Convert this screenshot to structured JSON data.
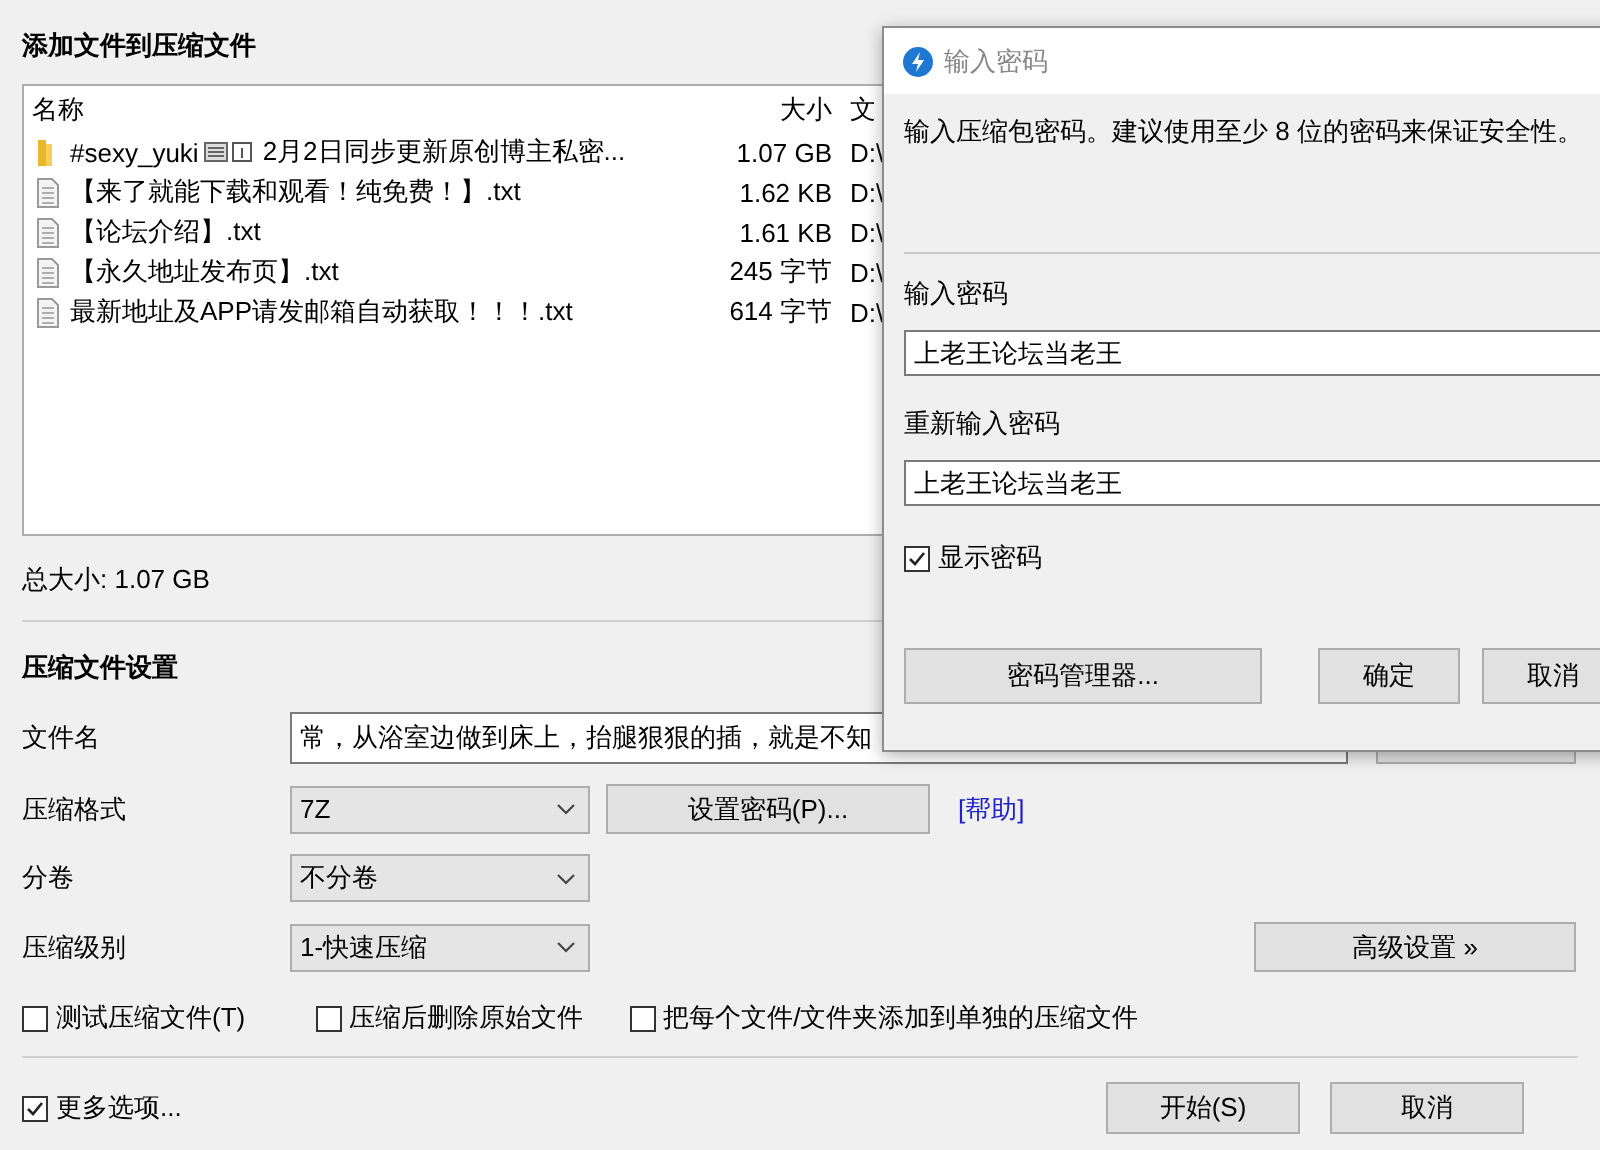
{
  "window": {
    "title": "添加文件到压缩文件"
  },
  "file_list": {
    "columns": [
      "名称",
      "大小",
      "文"
    ],
    "rows": [
      {
        "kind": "folder",
        "name": "#sexy_yuki",
        "name_suffix": "2月2日同步更新原创博主私密...",
        "size": "1.07 GB",
        "column_3": "D:\\"
      },
      {
        "kind": "file",
        "name": "【来了就能下载和观看！纯免费！】.txt",
        "size": "1.62 KB",
        "column_3": "D:\\"
      },
      {
        "kind": "file",
        "name": "【论坛介绍】.txt",
        "size": "1.61 KB",
        "column_3": "D:\\"
      },
      {
        "kind": "file",
        "name": "【永久地址发布页】.txt",
        "size": "245 字节",
        "column_3": "D:\\"
      },
      {
        "kind": "file",
        "name": "最新地址及APP请发邮箱自动获取！！！.txt",
        "size": "614 字节",
        "column_3": "D:\\"
      }
    ]
  },
  "total_size": "总大小: 1.07 GB",
  "settings": {
    "title": "压缩文件设置",
    "filename": {
      "label": "文件名",
      "value": "常，从浴室边做到床上，抬腿狠狠的插，就是不知"
    },
    "format": {
      "label": "压缩格式",
      "value": "7Z"
    },
    "set_password_button": "设置密码(P)...",
    "help_link": "[帮助]",
    "volume": {
      "label": "分卷",
      "value": "不分卷"
    },
    "level": {
      "label": "压缩级别",
      "value": "1-快速压缩"
    },
    "advanced_button": "高级设置 »",
    "options": [
      {
        "label": "测试压缩文件(T)",
        "checked": false
      },
      {
        "label": "压缩后删除原始文件",
        "checked": false
      },
      {
        "label": "把每个文件/文件夹添加到单独的压缩文件",
        "checked": false
      }
    ]
  },
  "more_options": {
    "label": "更多选项...",
    "checked": true
  },
  "buttons": [
    "开始(S)",
    "取消"
  ],
  "password_dialog": {
    "title": "输入密码",
    "description": "输入压缩包密码。建议使用至少 8 位的密码来保证安全性。",
    "password_label": "输入密码",
    "password": "上老王论坛当老王",
    "confirm_label": "重新输入密码",
    "confirm": "上老王论坛当老王",
    "show_password": {
      "label": "显示密码",
      "checked": true
    },
    "buttons": [
      "密码管理器...",
      "确定",
      "取消"
    ]
  }
}
